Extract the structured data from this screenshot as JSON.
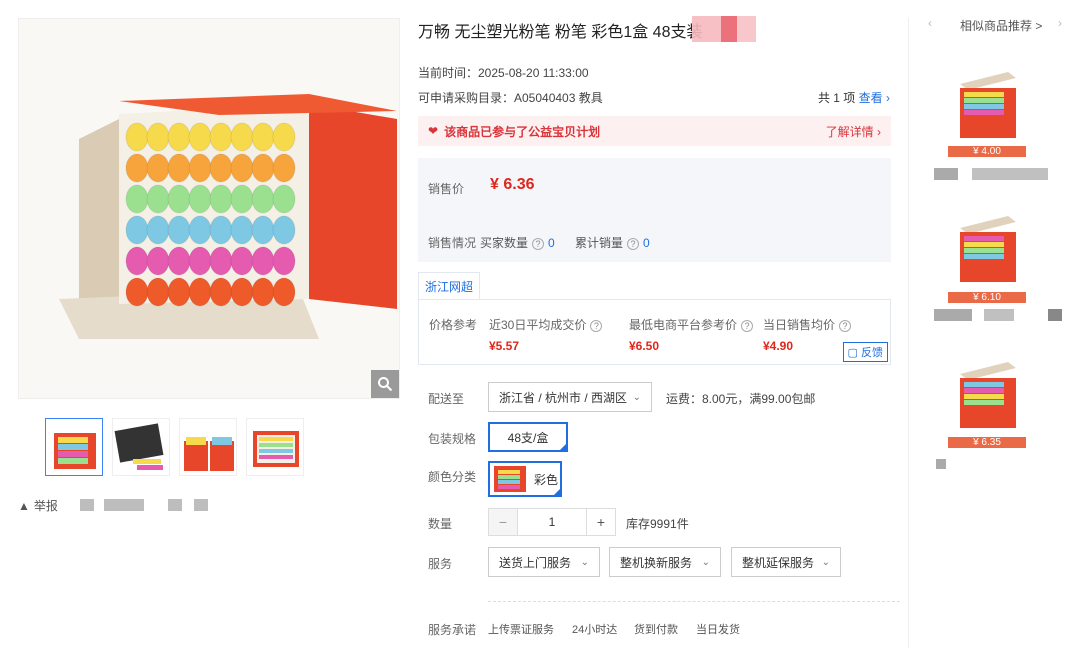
{
  "product": {
    "title": "万畅 无尘塑光粉笔 粉笔 彩色1盒 48支装",
    "current_time": "当前时间：2025-08-20 11:33:00",
    "catalog": "可申请采购目录：A05040403 教具",
    "count_text": "共 1 项",
    "count_link": "查看"
  },
  "charity": {
    "text": "该商品已参与了公益宝贝计划",
    "link": "了解详情"
  },
  "pricing": {
    "price_label": "销售价",
    "price": "¥ 6.36",
    "sales_label": "销售情况",
    "buyers_label": "买家数量",
    "buyers_value": "0",
    "sold_label": "累计销量",
    "sold_value": "0"
  },
  "reference": {
    "tab": "浙江网超",
    "label": "价格参考",
    "cols": [
      {
        "label": "近30日平均成交价",
        "price": "¥5.57"
      },
      {
        "label": "最低电商平台参考价",
        "price": "¥6.50"
      },
      {
        "label": "当日销售均价",
        "price": "¥4.90"
      }
    ],
    "feedback": "反馈"
  },
  "options": {
    "ship_label": "配送至",
    "ship_value": "浙江省 / 杭州市 / 西湖区",
    "freight": "运费：8.00元，满99.00包邮",
    "pack_label": "包装规格",
    "pack_value": "48支/盒",
    "color_label": "颜色分类",
    "color_value": "彩色",
    "qty_label": "数量",
    "qty_minus": "−",
    "qty_value": "1",
    "qty_plus": "+",
    "stock": "库存9991件",
    "service_label": "服务",
    "services": [
      "送货上门服务",
      "整机换新服务",
      "整机延保服务"
    ],
    "promise_label": "服务承诺",
    "promises": [
      "上传票证服务",
      "24小时达",
      "货到付款",
      "当日发货"
    ]
  },
  "gallery": {
    "report": "举报"
  },
  "recommend": {
    "title": "相似商品推荐",
    "title_arrow": ">",
    "nav_left": "‹",
    "nav_right": "›",
    "prices": [
      "¥ 4.00",
      "¥ 6.10",
      "¥ 6.35"
    ]
  },
  "colors": {
    "accent": "#1f6fe0",
    "price_red": "#e1251b",
    "charity_bg": "#fdf0f0"
  }
}
